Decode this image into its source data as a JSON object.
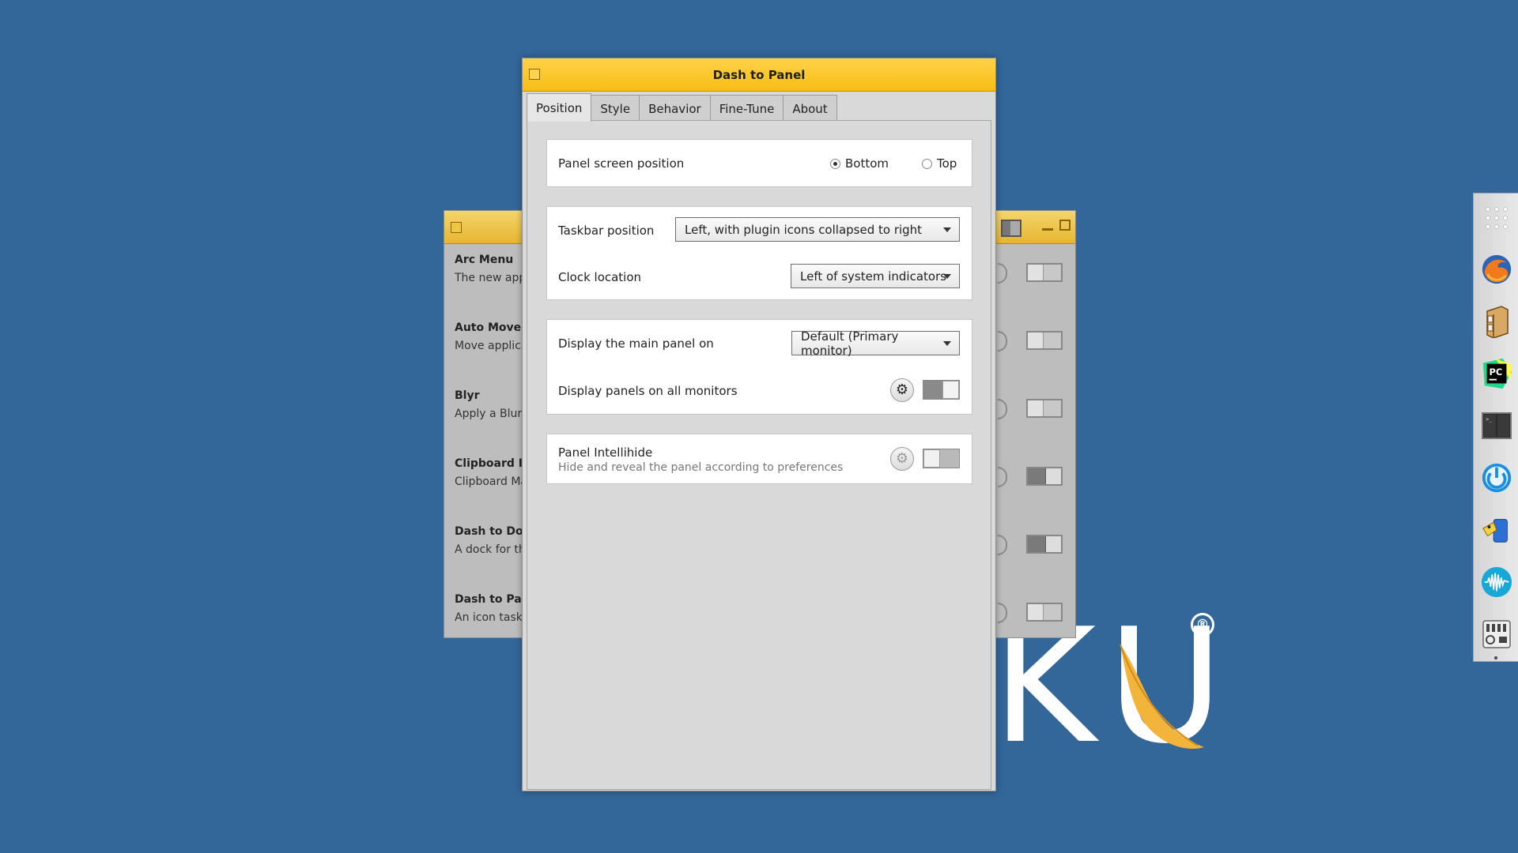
{
  "wallpaper": {
    "logo_text": "KU",
    "registered_mark": "®"
  },
  "background_window": {
    "extensions": [
      {
        "title": "Arc Menu",
        "description": "The new appl"
      },
      {
        "title": "Auto Move V",
        "description": "Move applica"
      },
      {
        "title": "Blyr",
        "description": "Apply a Blur I"
      },
      {
        "title": "Clipboard In",
        "description": "Clipboard Ma and caches cl"
      },
      {
        "title": "Dash to Doc",
        "description": "A dock for th in a dock for"
      },
      {
        "title": "Dash to Pan",
        "description": "An icon taskb so that the ap"
      }
    ],
    "toggle_states": [
      false,
      false,
      false,
      true,
      true,
      false
    ]
  },
  "dialog": {
    "title": "Dash to Panel",
    "tabs": [
      {
        "label": "Position",
        "active": true
      },
      {
        "label": "Style",
        "active": false
      },
      {
        "label": "Behavior",
        "active": false
      },
      {
        "label": "Fine-Tune",
        "active": false
      },
      {
        "label": "About",
        "active": false
      }
    ],
    "panel_position": {
      "label": "Panel screen position",
      "options": [
        "Bottom",
        "Top"
      ],
      "selected": "Bottom"
    },
    "taskbar_position": {
      "label": "Taskbar position",
      "value": "Left, with plugin icons collapsed to right"
    },
    "clock_location": {
      "label": "Clock location",
      "value": "Left of system indicators"
    },
    "main_panel": {
      "label": "Display the main panel on",
      "value": "Default (Primary monitor)"
    },
    "all_monitors": {
      "label": "Display panels on all monitors",
      "enabled": true
    },
    "intellihide": {
      "label": "Panel Intellihide",
      "description": "Hide and reveal the panel according to preferences",
      "enabled": false
    }
  },
  "dock": {
    "icons": [
      "app-grid-icon",
      "firefox-icon",
      "file-cabinet-icon",
      "pycharm-icon",
      "terminal-icon",
      "power-app-icon",
      "mail-bird-icon",
      "audio-wave-icon",
      "mixer-icon"
    ]
  },
  "colors": {
    "desktop": "#336699",
    "titlebar": "#f6bd13",
    "dialog_bg": "#d9d9d9"
  }
}
